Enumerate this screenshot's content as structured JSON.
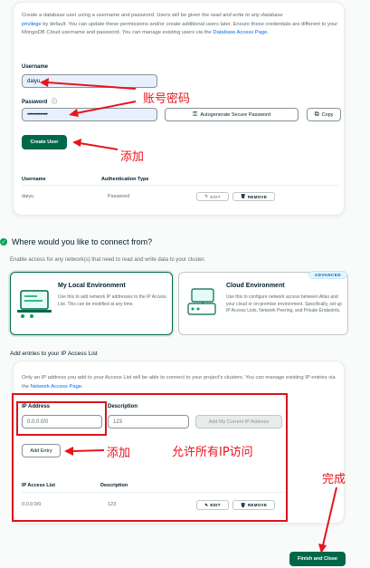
{
  "db_user": {
    "intro_p1": "Create a database user using a username and password. Users will be given the ",
    "intro_em": "read and write to any database",
    "intro_link1": "privilege",
    "intro_p2": " by default. You can update these permissions and/or create additional users later. Ensure these credentials are different to your MongoDB Cloud username and password. You can manage existing users via the ",
    "intro_link2": "Database Access Page",
    "intro_end": ".",
    "username_label": "Username",
    "username_value": "daiyu",
    "password_label": "Password",
    "password_value": "••••••••••••••",
    "autogenerate_label": "Autogenerate Secure Password",
    "copy_label": "Copy",
    "create_user_label": "Create User",
    "table_headers": [
      "Username",
      "Authentication Type"
    ],
    "rows": [
      {
        "username": "daiyu",
        "auth": "Password",
        "edit": "EDIT",
        "remove": "REMOVE"
      }
    ]
  },
  "connect": {
    "title": "Where would you like to connect from?",
    "subtitle": "Enable access for any network(s) that need to read and write data to your cluster.",
    "local": {
      "title": "My Local Environment",
      "desc": "Use this to add network IP addresses to the IP Access List. This can be modified at any time."
    },
    "cloud": {
      "badge": "ADVANCED",
      "title": "Cloud Environment",
      "desc": "Use this to configure network access between Atlas and your cloud or on-premise environment. Specifically, set up IP Access Lists, Network Peering, and Private Endpoints."
    }
  },
  "ip_access": {
    "heading": "Add entries to your IP Access List",
    "intro_p1": "Only an IP address you add to your Access List will be able to connect to your project's clusters. You can manage existing IP entries via the ",
    "intro_link": "Network Access Page",
    "intro_end": ".",
    "ip_label": "IP Address",
    "ip_value": "0.0.0.0/0",
    "desc_label": "Description",
    "desc_value": "123",
    "add_current_label": "Add My Current IP Address",
    "add_entry_label": "Add Entry",
    "table_headers": [
      "IP Access List",
      "Description"
    ],
    "rows": [
      {
        "ip": "0.0.0.0/0",
        "description": "123",
        "edit": "EDIT",
        "remove": "REMOVE"
      }
    ]
  },
  "finish_label": "Finish and Close",
  "annotations": {
    "account_password": "账号密码",
    "add1": "添加",
    "add2": "添加",
    "allow_all_ip": "允许所有IP访问",
    "done": "完成"
  },
  "colors": {
    "brand_green": "#00684a",
    "annotation_red": "#e8141c",
    "link_blue": "#016bf8"
  }
}
